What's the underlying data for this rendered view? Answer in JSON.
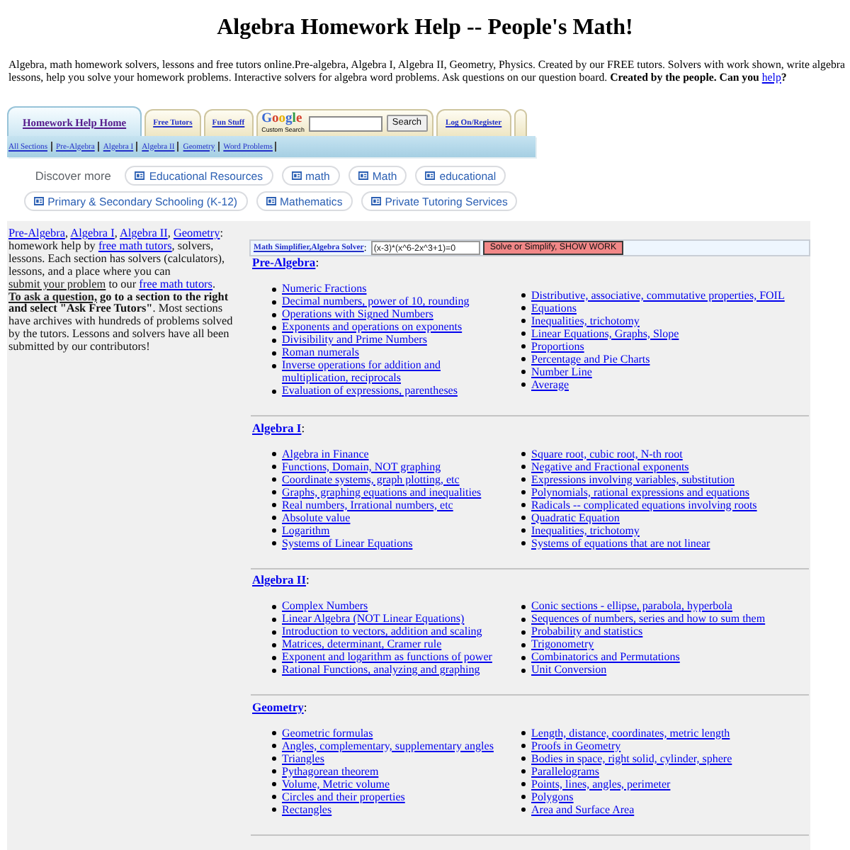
{
  "title": "Algebra Homework Help -- People's Math!",
  "intro": {
    "text": "Algebra, math homework solvers, lessons and free tutors online.Pre-algebra, Algebra I, Algebra II, Geometry, Physics. Created by our FREE tutors. Solvers with work shown, write algebra lessons, help you solve your homework problems. Interactive solvers for algebra word problems. Ask questions on our question board. **Created by the people. Can you**",
    "link": "help",
    "after": "**?**"
  },
  "tabs": [
    {
      "kind": "link",
      "label": "Homework Help Home",
      "selected": true
    },
    {
      "kind": "link",
      "label": "Free Tutors",
      "selected": false
    },
    {
      "kind": "link",
      "label": "Fun Stuff",
      "selected": false
    },
    {
      "kind": "search",
      "logo": "Google",
      "caption": "Custom Search",
      "button": "Search",
      "selected": false
    },
    {
      "kind": "link",
      "label": "Log On/Register",
      "selected": false
    },
    {
      "kind": "blank",
      "selected": false
    }
  ],
  "subnav": [
    "All Sections",
    "Pre-Algebra",
    "Algebra I",
    "Algebra II",
    "Geometry",
    "Word Problems"
  ],
  "discover": {
    "label": "Discover more",
    "chips": [
      "Educational Resources",
      "math",
      "Math",
      "educational",
      "Primary & Secondary Schooling (K-12)",
      "Mathematics",
      "Private Tutoring Services"
    ]
  },
  "about": [
    {
      "kind": "link",
      "text": "Pre-Algebra"
    },
    {
      "kind": "text",
      "text": ", "
    },
    {
      "kind": "link",
      "text": "Algebra I"
    },
    {
      "kind": "text",
      "text": ", "
    },
    {
      "kind": "link",
      "text": "Algebra II"
    },
    {
      "kind": "text",
      "text": ", "
    },
    {
      "kind": "link",
      "text": "Geometry"
    },
    {
      "kind": "text",
      "text": ": homework help by "
    },
    {
      "kind": "link",
      "text": "free math tutors"
    },
    {
      "kind": "text",
      "text": ", solvers, lessons. Each section has solvers (calculators), lessons, and a place where you can "
    },
    {
      "kind": "dark-link",
      "text": "submit your problem"
    },
    {
      "kind": "text",
      "text": " to our "
    },
    {
      "kind": "link",
      "text": "free math tutors"
    },
    {
      "kind": "text",
      "text": ". "
    },
    {
      "kind": "bold-link",
      "text": "To ask a question,"
    },
    {
      "kind": "bold",
      "text": " go to a section to the right and select \"Ask Free Tutors\""
    },
    {
      "kind": "text",
      "text": ". Most sections have archives with hundreds of problems solved by the tutors. Lessons and solvers have all been submitted by our contributors!"
    }
  ],
  "solver": {
    "link": "Math Simplifier,Algebra Solver",
    "suffix": ":",
    "value": "(x-3)*(x^6-2x^3+1)=0",
    "button": "Solve or Simplify, SHOW WORK"
  },
  "sections": [
    {
      "title": "Pre-Algebra",
      "suffix": ":",
      "left": [
        "Numeric Fractions",
        "Decimal numbers, power of 10, rounding",
        "Operations with Signed Numbers",
        "Exponents and operations on exponents",
        "Divisibility and Prime Numbers",
        "Roman numerals",
        "Inverse operations for addition and multiplication, reciprocals",
        "Evaluation of expressions, parentheses"
      ],
      "right": [
        "Distributive, associative, commutative properties, FOIL",
        "Equations",
        "Inequalities, trichotomy",
        "Linear Equations, Graphs, Slope",
        "Proportions",
        "Percentage and Pie Charts",
        "Number Line",
        "Average"
      ]
    },
    {
      "title": "Algebra I",
      "suffix": ":",
      "left": [
        "Algebra in Finance",
        "Functions, Domain, NOT graphing",
        "Coordinate systems, graph plotting, etc",
        "Graphs, graphing equations and inequalities",
        "Real numbers, Irrational numbers, etc",
        "Absolute value",
        "Logarithm",
        "Systems of Linear Equations"
      ],
      "right": [
        "Square root, cubic root, N-th root",
        "Negative and Fractional exponents",
        "Expressions involving variables, substitution",
        "Polynomials, rational expressions and equations",
        "Radicals -- complicated equations involving roots",
        "Quadratic Equation",
        "Inequalities, trichotomy",
        "Systems of equations that are not linear"
      ]
    },
    {
      "title": "Algebra II",
      "suffix": ":",
      "left": [
        "Complex Numbers",
        "Linear Algebra (NOT Linear Equations)",
        "Introduction to vectors, addition and scaling",
        "Matrices, determinant, Cramer rule",
        "Exponent and logarithm as functions of power",
        "Rational Functions, analyzing and graphing"
      ],
      "right": [
        "Conic sections - ellipse, parabola, hyperbola",
        "Sequences of numbers, series and how to sum them",
        "Probability and statistics",
        "Trigonometry",
        "Combinatorics and Permutations",
        "Unit Conversion"
      ]
    },
    {
      "title": "Geometry",
      "suffix": ":",
      "left": [
        "Geometric formulas",
        "Angles, complementary, supplementary angles",
        "Triangles",
        "Pythagorean theorem",
        "Volume, Metric volume",
        "Circles and their properties",
        "Rectangles"
      ],
      "right": [
        "Length, distance, coordinates, metric length",
        "Proofs in Geometry",
        "Bodies in space, right solid, cylinder, sphere",
        "Parallelograms",
        "Points, lines, angles, perimeter",
        "Polygons",
        "Area and Surface Area"
      ]
    }
  ]
}
